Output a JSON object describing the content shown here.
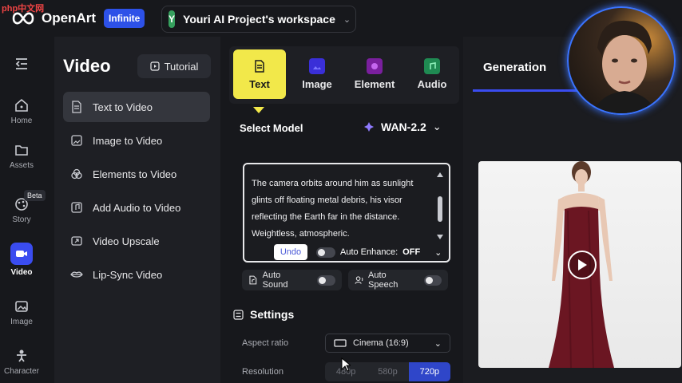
{
  "watermark": "php中文网",
  "brand": {
    "name": "OpenArt",
    "badge": "Infinite"
  },
  "workspace": {
    "avatar_letter": "Y",
    "name": "Youri AI Project's workspace"
  },
  "rail": {
    "items": [
      {
        "label": "Home",
        "icon": "home-icon"
      },
      {
        "label": "Assets",
        "icon": "folder-icon"
      },
      {
        "label": "Story",
        "icon": "story-icon"
      },
      {
        "label": "Video",
        "icon": "video-icon",
        "active": true
      },
      {
        "label": "Image",
        "icon": "image-icon"
      },
      {
        "label": "Character",
        "icon": "character-icon"
      }
    ],
    "beta_badge": "Beta"
  },
  "menu": {
    "title": "Video",
    "tutorial_label": "Tutorial",
    "items": [
      {
        "label": "Text to Video",
        "active": true
      },
      {
        "label": "Image to Video"
      },
      {
        "label": "Elements to Video"
      },
      {
        "label": "Add Audio to Video"
      },
      {
        "label": "Video Upscale"
      },
      {
        "label": "Lip-Sync Video"
      }
    ]
  },
  "tabs": [
    {
      "label": "Text",
      "active": true
    },
    {
      "label": "Image"
    },
    {
      "label": "Element"
    },
    {
      "label": "Audio"
    }
  ],
  "model": {
    "label": "Select Model",
    "selected": "WAN-2.2"
  },
  "prompt": {
    "text": "The camera orbits around him as sunlight glints off floating metal debris, his visor reflecting the Earth far in the distance. Weightless, atmospheric.",
    "undo_label": "Undo",
    "auto_enhance_label": "Auto Enhance:",
    "auto_enhance_value": "OFF"
  },
  "extras": {
    "auto_sound": "Auto Sound",
    "auto_speech": "Auto Speech"
  },
  "settings": {
    "title": "Settings",
    "aspect_label": "Aspect ratio",
    "aspect_value": "Cinema (16:9)",
    "resolution_label": "Resolution",
    "resolution_options": [
      "480p",
      "580p",
      "720p"
    ],
    "resolution_selected": "720p"
  },
  "generation": {
    "title": "Generation"
  },
  "colors": {
    "accent": "#3a4cf0",
    "tab_active": "#f2e84a",
    "dress": "#6b1622"
  }
}
